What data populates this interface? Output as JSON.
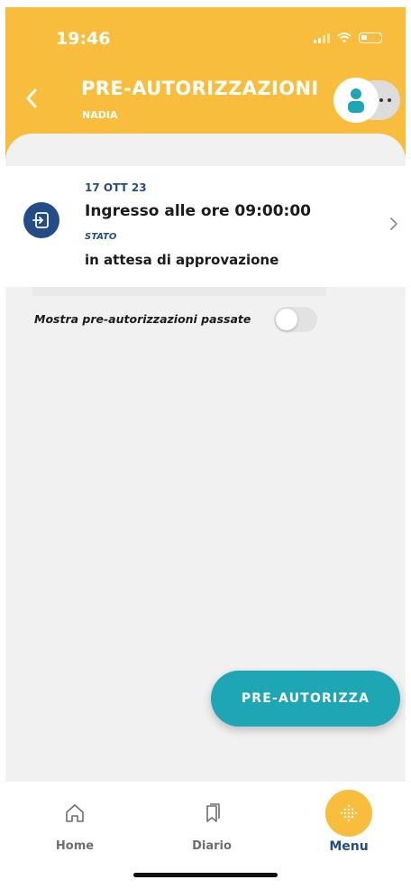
{
  "status_bar": {
    "time": "19:46"
  },
  "header": {
    "title": "PRE-AUTORIZZAZIONI",
    "subtitle": "NADIA"
  },
  "card": {
    "date": "17 OTT 23",
    "title": "Ingresso alle ore 09:00:00",
    "state_label": "STATO",
    "state_value": "in attesa di approvazione",
    "icon": "enter-icon"
  },
  "toggle": {
    "label": "Mostra pre-autorizzazioni passate",
    "on": false
  },
  "fab": {
    "label": "PRE-AUTORIZZA"
  },
  "bottom_nav": {
    "items": [
      {
        "label": "Home",
        "icon": "home-icon",
        "active": false
      },
      {
        "label": "Diario",
        "icon": "bookmarks-icon",
        "active": false
      },
      {
        "label": "Menu",
        "icon": "grid-dots-icon",
        "active": true
      }
    ]
  },
  "colors": {
    "header_yellow": "#f8bd3c",
    "navy": "#244d87",
    "teal": "#1fa6b5",
    "background": "#f1f1f1"
  }
}
